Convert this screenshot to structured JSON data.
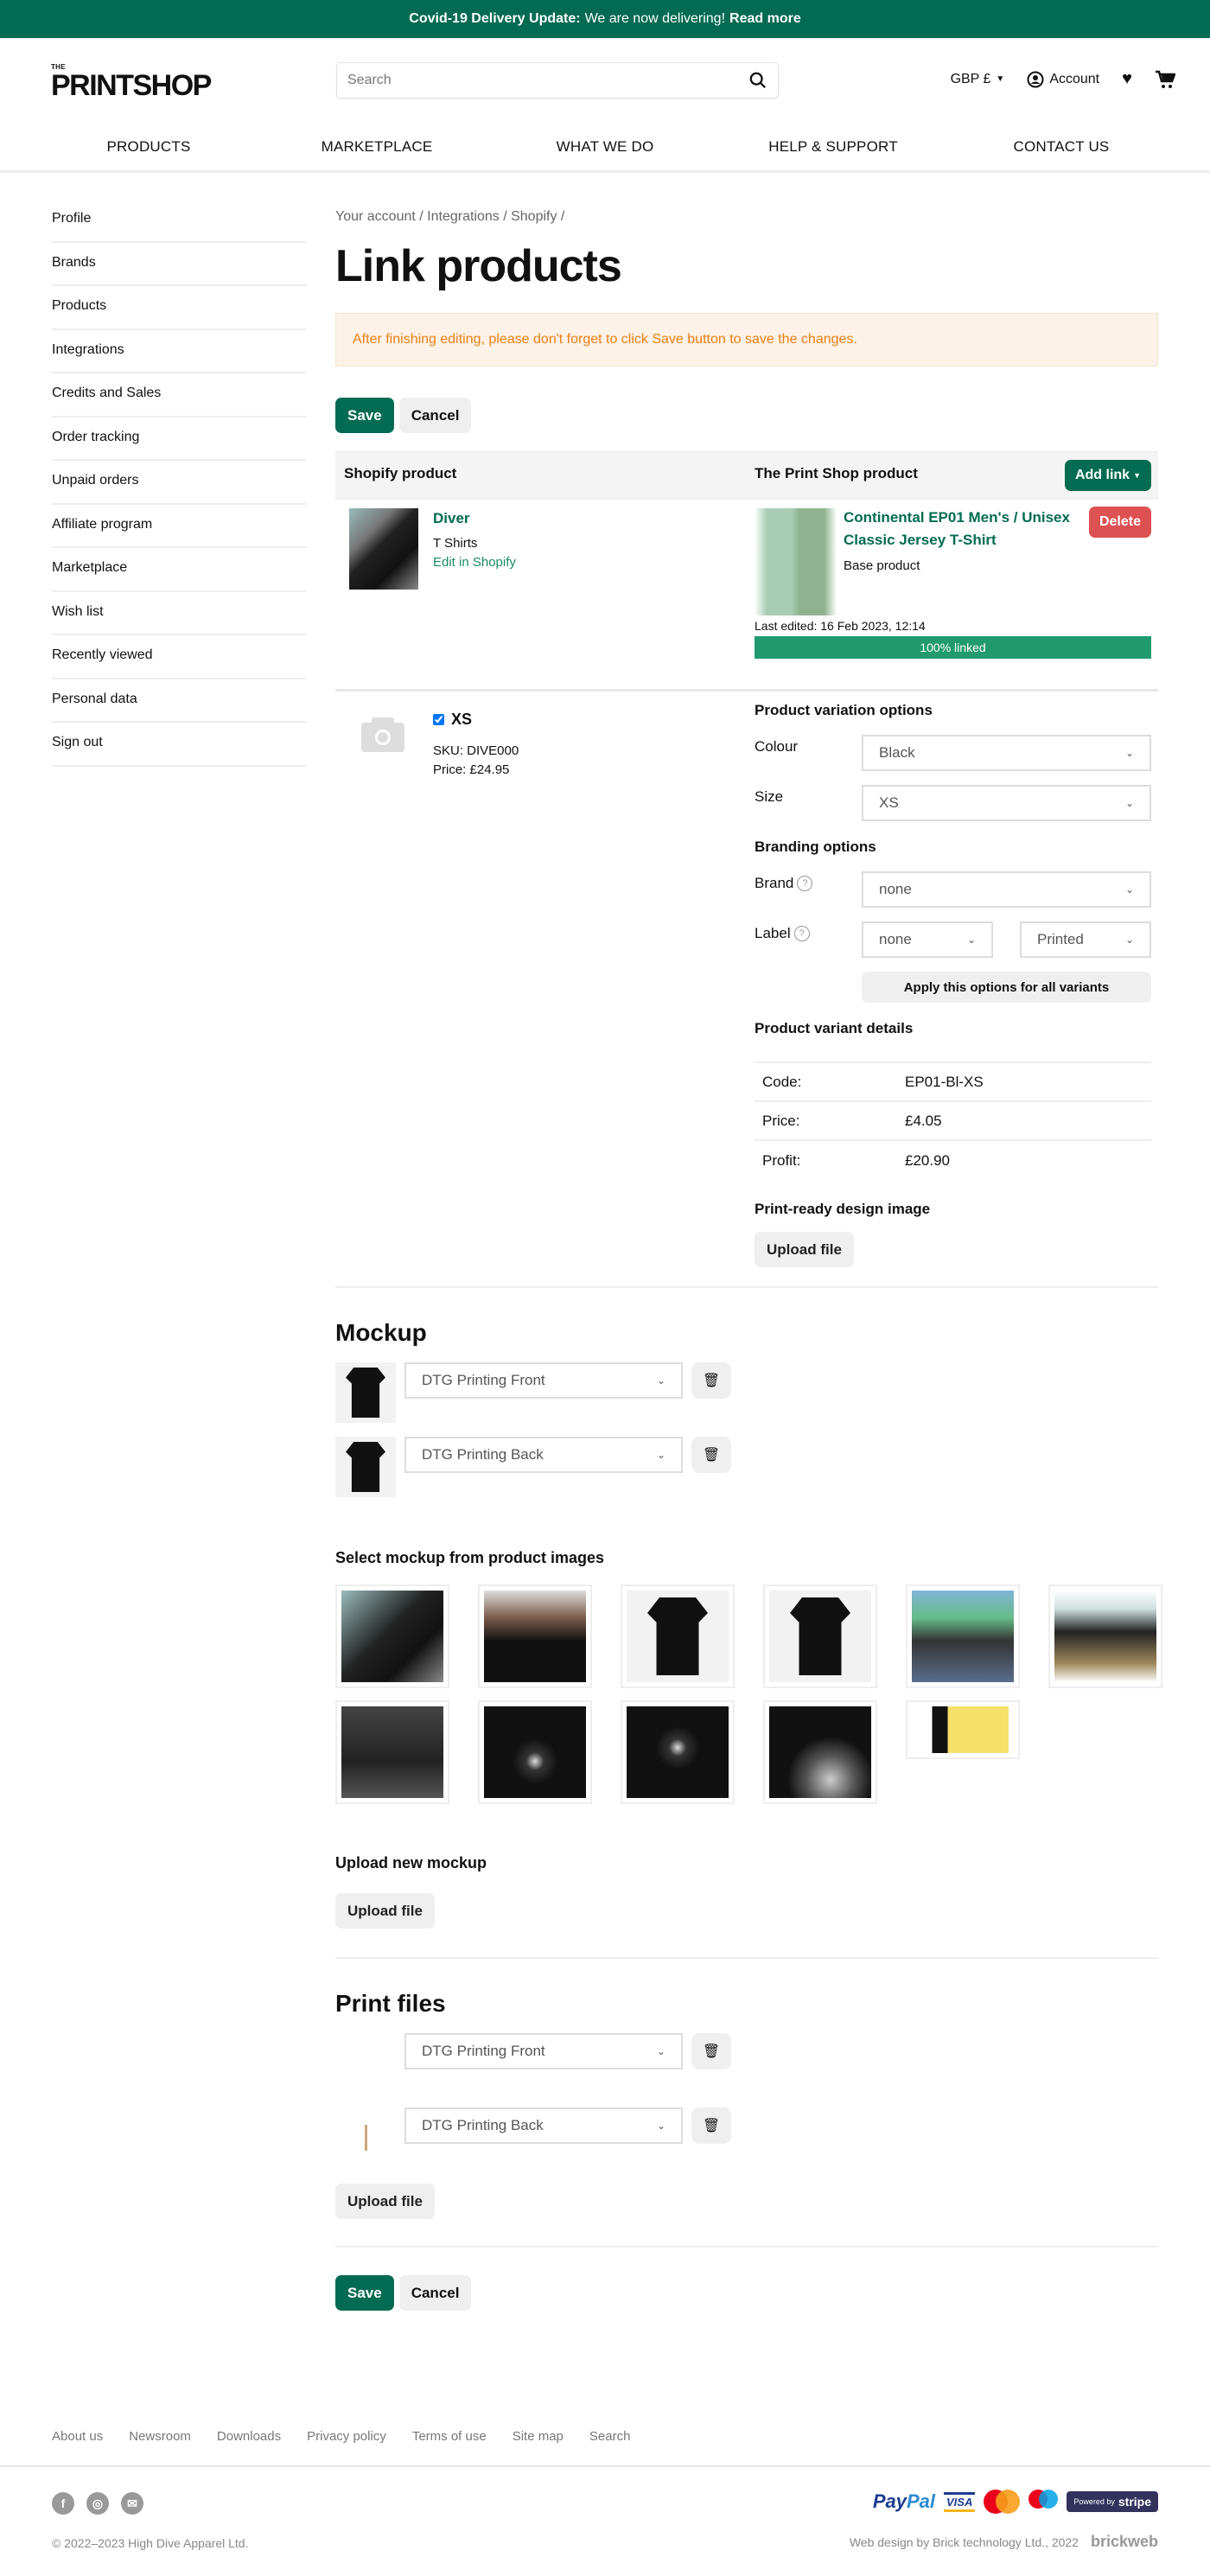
{
  "banner": {
    "bold": "Covid-19 Delivery Update:",
    "text": "We are now delivering!",
    "link": "Read more"
  },
  "header": {
    "logo_small": "THE",
    "logo_main": "PRINTSHOP",
    "search_placeholder": "Search",
    "currency": "GBP £",
    "account": "Account"
  },
  "nav": [
    "PRODUCTS",
    "MARKETPLACE",
    "WHAT WE DO",
    "HELP & SUPPORT",
    "CONTACT US"
  ],
  "sidebar": [
    "Profile",
    "Brands",
    "Products",
    "Integrations",
    "Credits and Sales",
    "Order tracking",
    "Unpaid orders",
    "Affiliate program",
    "Marketplace",
    "Wish list",
    "Recently viewed",
    "Personal data",
    "Sign out"
  ],
  "breadcrumb": "Your account / Integrations / Shopify /",
  "title": "Link products",
  "alert": "After finishing editing, please don't forget to click Save button to save the changes.",
  "buttons": {
    "save": "Save",
    "cancel": "Cancel",
    "add_link": "Add link",
    "delete": "Delete",
    "upload": "Upload file",
    "apply": "Apply this options for all variants"
  },
  "table": {
    "col1": "Shopify product",
    "col2": "The Print Shop product"
  },
  "shopify_product": {
    "name": "Diver",
    "type": "T Shirts",
    "edit": "Edit in Shopify"
  },
  "printshop_product": {
    "name": "Continental EP01 Men's / Unisex Classic Jersey T-Shirt",
    "base": "Base product",
    "edited": "Last edited: 16 Feb 2023, 12:14",
    "linked_percent": 100,
    "linked_label": "100% linked"
  },
  "variant": {
    "size": "XS",
    "checked": true,
    "sku": "SKU: DIVE000",
    "price": "Price: £24.95",
    "variation_heading": "Product variation options",
    "colour_label": "Colour",
    "colour": "Black",
    "size_label": "Size",
    "size_value": "XS",
    "branding_heading": "Branding options",
    "brand_label": "Brand",
    "brand": "none",
    "label_label": "Label",
    "label": "none",
    "label_type": "Printed",
    "details_heading": "Product variant details",
    "details": [
      {
        "k": "Code:",
        "v": "EP01-Bl-XS"
      },
      {
        "k": "Price:",
        "v": "£4.05"
      },
      {
        "k": "Profit:",
        "v": "£20.90"
      }
    ],
    "design_heading": "Print-ready design image"
  },
  "mockup": {
    "heading": "Mockup",
    "items": [
      "DTG Printing Front",
      "DTG Printing Back"
    ],
    "select_heading": "Select mockup from product images",
    "upload_heading": "Upload new mockup"
  },
  "print_files": {
    "heading": "Print files",
    "items": [
      "DTG Printing Front",
      "DTG Printing Back"
    ]
  },
  "footer": {
    "links": [
      "About us",
      "Newsroom",
      "Downloads",
      "Privacy policy",
      "Terms of use",
      "Site map",
      "Search"
    ],
    "copyright": "© 2022–2023 High Dive Apparel Ltd.",
    "credit": "Web design by Brick technology Ltd., 2022",
    "credit_brand": "brickweb",
    "payments": [
      "PayPal",
      "VISA",
      "Mastercard",
      "Maestro",
      "Powered by stripe"
    ]
  },
  "colors": {
    "brand": "#036b52",
    "progress": "#229a6f",
    "delete": "#dd5152",
    "alert_text": "#e87e16",
    "alert_bg": "#fdf2e8"
  }
}
